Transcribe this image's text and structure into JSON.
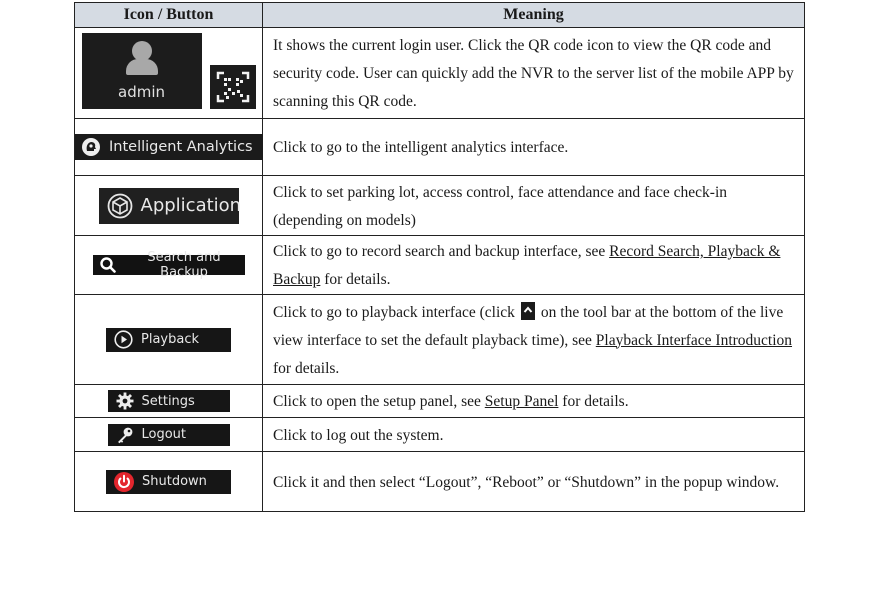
{
  "header": {
    "col1": "Icon / Button",
    "col2": "Meaning"
  },
  "rows": [
    {
      "button_label": "admin",
      "icon": "user-avatar-icon",
      "icon2": "qr-code-icon",
      "text": "It shows the current login user. Click the QR code icon to view the QR code and security code. User can quickly add the NVR to the server list of the mobile APP by scanning this QR code."
    },
    {
      "button_label": "Intelligent Analytics",
      "icon": "intelligent-analytics-icon",
      "text": "Click to go to the intelligent analytics interface."
    },
    {
      "button_label": "Application",
      "icon": "application-cube-icon",
      "text": "Click to set parking lot, access control, face attendance and face check-in (depending on models)"
    },
    {
      "button_label": "Search and Backup",
      "icon": "search-icon",
      "text_before": "Click to go to record search and backup interface, see ",
      "link": "Record Search, Playback & Backup",
      "text_after": " for details."
    },
    {
      "button_label": "Playback",
      "icon": "playback-icon",
      "text_before": "Click to go to playback interface (click",
      "inline_icon": "chevron-up-icon",
      "text_middle": "on the tool bar at the bottom of the live view interface to set the default playback time), see ",
      "link": "Playback Interface Introduction",
      "text_after": " for details."
    },
    {
      "button_label": "Settings",
      "icon": "gear-icon",
      "text_before": "Click to open the setup panel, see ",
      "link": "Setup Panel",
      "text_after": " for details."
    },
    {
      "button_label": "Logout",
      "icon": "key-icon",
      "text": "Click to log out the system."
    },
    {
      "button_label": "Shutdown",
      "icon": "power-icon",
      "text": "Click it and then select “Logout”, “Reboot” or “Shutdown” in the popup window."
    }
  ],
  "colors": {
    "header_bg": "#d5dbe3",
    "button_bg": "#1b1b1b",
    "shutdown_red": "#e3262d"
  }
}
